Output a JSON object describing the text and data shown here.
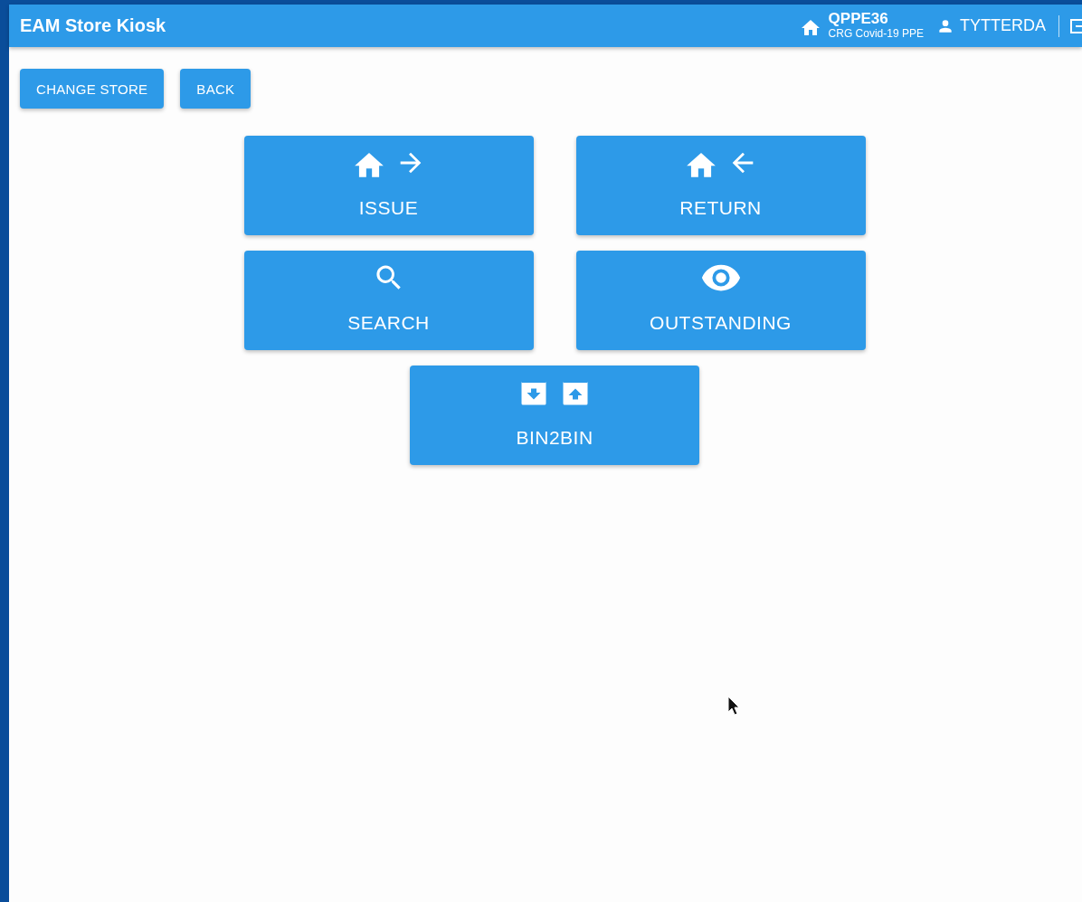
{
  "app_bar": {
    "title": "EAM Store Kiosk",
    "store_code": "QPPE36",
    "store_name": "CRG Covid-19 PPE",
    "user": "TYTTERDA"
  },
  "actions": [
    "CHANGE STORE",
    "BACK"
  ],
  "tiles": [
    {
      "kind": "issue",
      "label": "ISSUE"
    },
    {
      "kind": "return",
      "label": "RETURN"
    },
    {
      "kind": "search",
      "label": "SEARCH"
    },
    {
      "kind": "outstanding",
      "label": "OUTSTANDING"
    },
    {
      "kind": "bin2bin",
      "label": "BIN2BIN"
    }
  ]
}
